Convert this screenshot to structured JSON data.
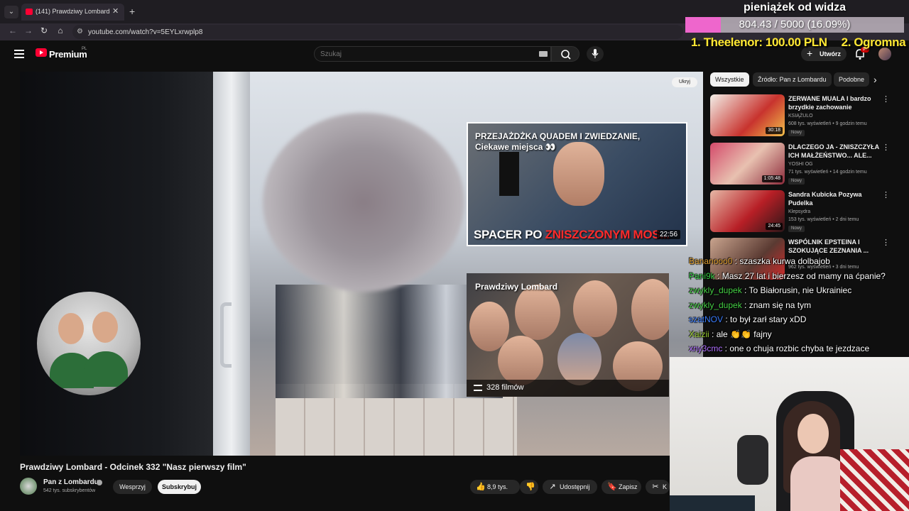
{
  "browser": {
    "tab_title": "(141) Prawdziwy Lombard",
    "url": "youtube.com/watch?v=5EYLxrwplp8",
    "new_tab_symbol": "+",
    "close_symbol": "✕"
  },
  "header": {
    "logo": "Premium",
    "country": "PL",
    "search_placeholder": "Szukaj",
    "create_label": "Utwórz",
    "notifications_count": "9+"
  },
  "player": {
    "hide_label": "Ukryj",
    "card1": {
      "title": "PRZEJAŻDŻKA QUADEM I ZWIEDZANIE, Ciekawe miejsca 👀",
      "overlay_white": "SPACER PO ",
      "overlay_red": "ZNISZCZONYM MOS...",
      "duration": "22:56"
    },
    "card2": {
      "title": "Prawdziwy Lombard",
      "count": "328 filmów"
    }
  },
  "video": {
    "title": "Prawdziwy Lombard - Odcinek 332 \"Nasz pierwszy film\"",
    "channel": "Pan z Lombardu",
    "subscribers": "542 tys. subskrybentów",
    "support_label": "Wesprzyj",
    "subscribe_label": "Subskrybuj",
    "likes": "8,9 tys.",
    "share_label": "Udostępnij",
    "save_label": "Zapisz",
    "clip_label": "K"
  },
  "sidebar": {
    "chips": [
      "Wszystkie",
      "Źródło: Pan z Lombardu",
      "Podobne"
    ],
    "recommendations": [
      {
        "title": "ZERWANE MUALA I bardzo brzydkie zachowanie",
        "channel": "KSIĄŻULO",
        "meta": "608 tys. wyświetleń • 9 godzin temu",
        "badge": "Nowy",
        "duration": "30:18",
        "thumb_color": "#c8332e"
      },
      {
        "title": "DLACZEGO JA - ZNISZCZYŁA ICH MAŁŻEŃSTWO... ALE...",
        "channel": "YOSHI OG",
        "meta": "71 tys. wyświetleń • 14 godzin temu",
        "badge": "Nowy",
        "duration": "1:05:48",
        "thumb_color": "#d44a6a"
      },
      {
        "title": "Sandra Kubicka Pozywa Pudelka",
        "channel": "Klepsydra",
        "meta": "153 tys. wyświetleń • 2 dni temu",
        "badge": "Nowy",
        "duration": "24:45",
        "thumb_color": "#b81f26"
      },
      {
        "title": "WSPÓLNIK EPSTEINA I SZOKUJĄCE ZEZNANIA ...",
        "channel": "",
        "meta": "962 tys. wyświetleń • 3 dni temu",
        "badge": "",
        "duration": "",
        "thumb_color": "#5a3a32"
      }
    ]
  },
  "overlay": {
    "donation_title": "pieniążek od widza",
    "donation_progress": "804.43 / 5000 (16.09%)",
    "donation_fraction": 0.1609,
    "donation_top1": "1. Theelenor: 100.00 PLN",
    "donation_top2": "2. Ogromna",
    "chat": [
      {
        "user": "Bananooo0",
        "text": "szaszka kurwa dolbajob",
        "color": "#e0a032"
      },
      {
        "user": "Pani9k",
        "text": "Masz 27 lat i bierzesz od mamy na ćpanie?",
        "color": "#33cc44"
      },
      {
        "user": "zwykly_dupek",
        "text": "To Białorusin, nie Ukrainiec",
        "color": "#45d045"
      },
      {
        "user": "zwykly_dupek",
        "text": "znam się na tym",
        "color": "#45d045"
      },
      {
        "user": "szatNOV",
        "text": "to był zarł stary xDD",
        "color": "#3a7dff"
      },
      {
        "user": "Xaizii",
        "text": "ale 👏👏 fajny",
        "color": "#9acd32"
      },
      {
        "user": "xny3cmc",
        "text": "one o chuja rozbic chyba te jezdzace",
        "color": "#b070ff"
      }
    ]
  }
}
